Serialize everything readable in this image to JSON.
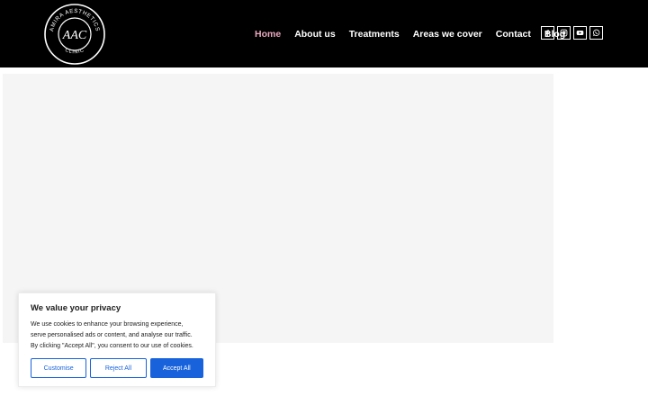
{
  "logo": {
    "ring_text": "AMIRA AESTHETICS",
    "bottom_text": "CLINIC",
    "monogram": "AAC"
  },
  "nav": {
    "items": [
      {
        "label": "Home",
        "active": true
      },
      {
        "label": "About us"
      },
      {
        "label": "Treatments"
      },
      {
        "label": "Areas we cover"
      },
      {
        "label": "Contact"
      },
      {
        "label": "Blog"
      }
    ]
  },
  "socials": [
    "facebook-icon",
    "instagram-icon",
    "youtube-icon",
    "whatsapp-icon"
  ],
  "colors": {
    "header_bg": "#000000",
    "active_nav": "#e8a8bd",
    "hero_placeholder": "#f5f5f5",
    "cookie_accent": "#1863dc"
  },
  "cookie": {
    "title": "We value your privacy",
    "lines": [
      "We use cookies to enhance your browsing experience,",
      "serve personalised ads or content, and analyse our traffic.",
      "By clicking \"Accept All\", you consent to our use of cookies."
    ],
    "customise": "Customise",
    "reject": "Reject All",
    "accept": "Accept All"
  }
}
